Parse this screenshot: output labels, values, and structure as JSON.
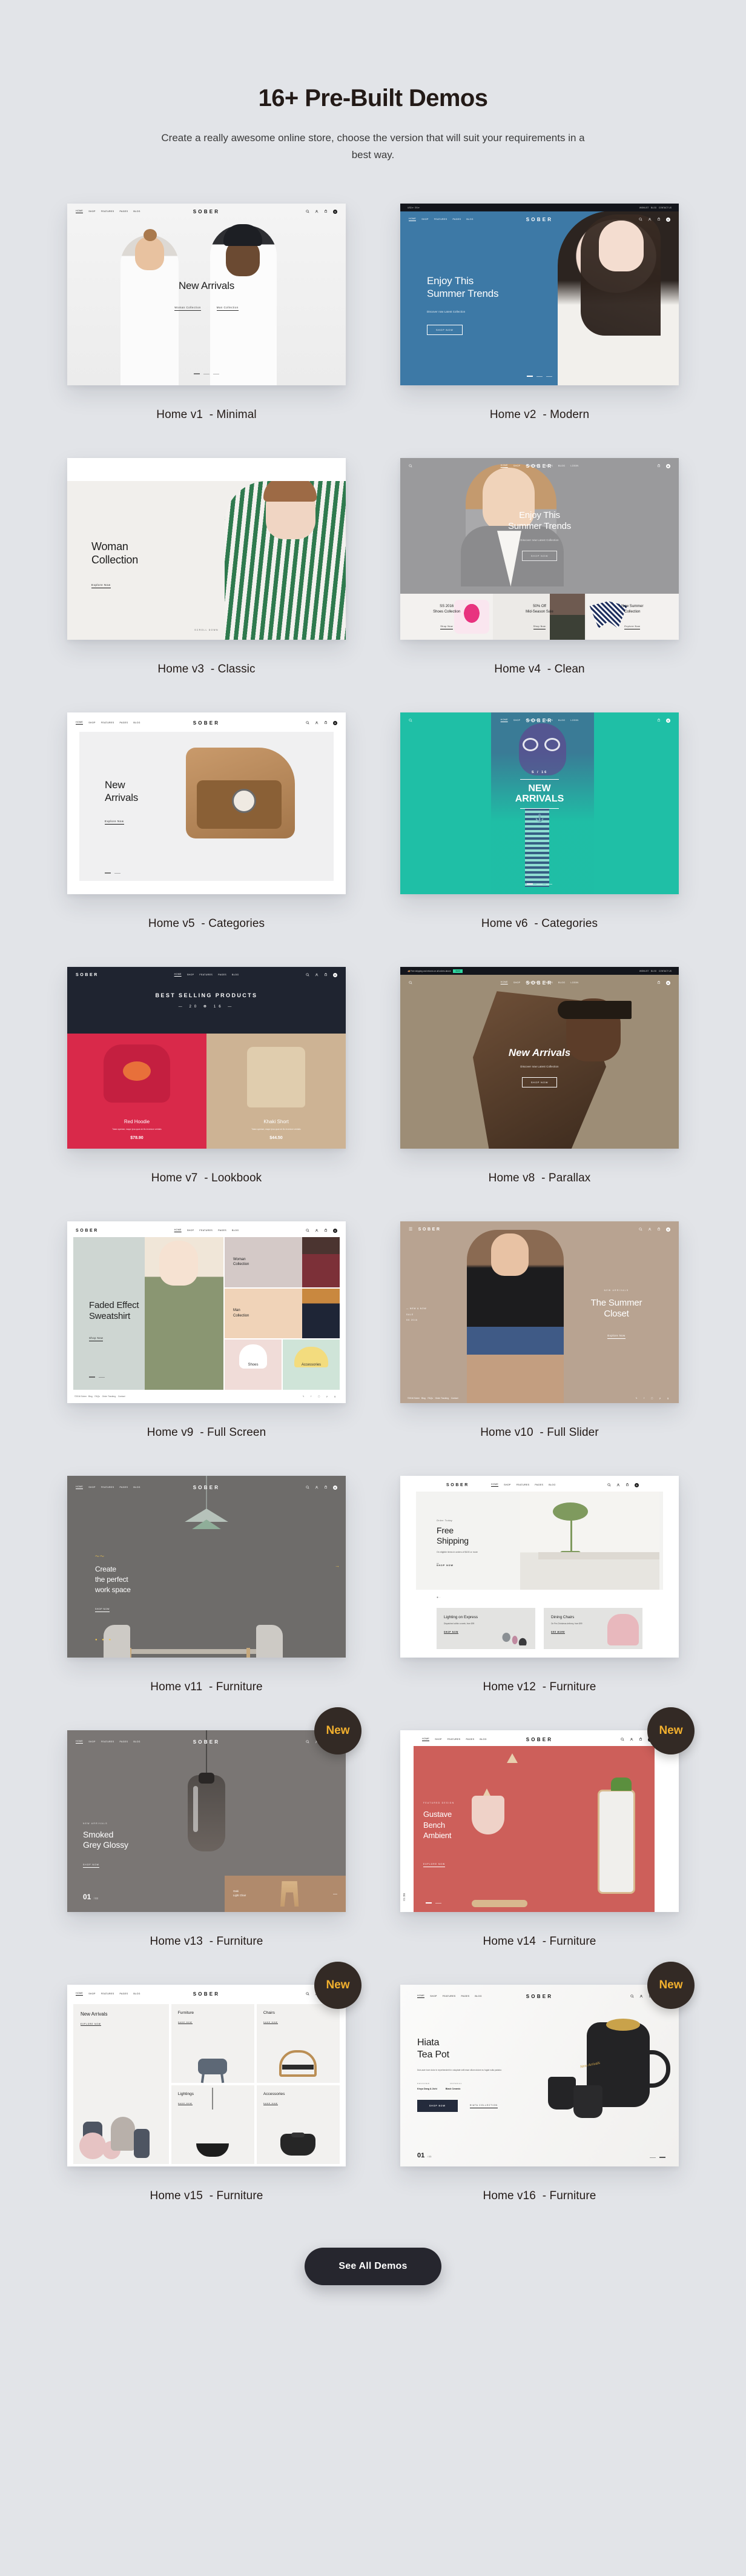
{
  "header": {
    "title": "16+ Pre-Built Demos",
    "subtitle": "Create a really awesome online store, choose the version that will suit your requirements in a best way."
  },
  "brand": "SOBER",
  "nav": {
    "items": [
      "HOME",
      "SHOP",
      "FEATURES",
      "PAGES",
      "BLOG",
      "LOGIN"
    ],
    "topbar_left": [
      "USD",
      "EN"
    ],
    "topbar_right": [
      "WISHLIST",
      "BLOG",
      "CONTACT US"
    ],
    "icons": [
      "search-icon",
      "user-icon",
      "cart-icon"
    ],
    "cart_count": "0"
  },
  "badge_new_label": "New",
  "colors": {
    "page_bg": "#e2e4e8",
    "heading": "#231a17",
    "badge_bg": "#332a25",
    "badge_text": "#f2b02e",
    "cta_bg": "#26262e",
    "v2_blue": "#3d79a6",
    "v6_teal": "#1fbfa6",
    "v7_red": "#d9294a",
    "v7_khaki": "#cdb394",
    "v7_dark": "#1f2430",
    "v8_taupe": "#9d8d76",
    "v10_beige": "#b8a391",
    "v11_grey": "#6e6c6a",
    "v13_grey": "#7a7674",
    "v14_coral": "#cd5f5a"
  },
  "demos": [
    {
      "id": "v1",
      "label": "Home v1  - Minimal",
      "badge": null,
      "hero": {
        "title": "New Arrivals",
        "links": [
          "Woman Collection",
          "Man Collection"
        ]
      }
    },
    {
      "id": "v2",
      "label": "Home v2  - Modern",
      "badge": null,
      "hero": {
        "title": "Enjoy This\nSummer Trends",
        "subtitle": "Discover now Latest Collection",
        "button": "SHOP NOW"
      }
    },
    {
      "id": "v3",
      "label": "Home v3  - Classic",
      "badge": null,
      "hero": {
        "title": "Woman\nCollection",
        "link": "Explore Now",
        "scroll": "SCROLL DOWN"
      }
    },
    {
      "id": "v4",
      "label": "Home v4  - Clean",
      "badge": null,
      "hero": {
        "title": "Enjoy This\nSummer Trends",
        "subtitle": "Discover now Latest Collection",
        "button": "SHOP NOW"
      },
      "tiles": [
        {
          "title": "SS 2016\nShoes Collection",
          "link": "Shop Now"
        },
        {
          "title": "50% Off\nMid-Season Sale",
          "link": "Shop Now"
        },
        {
          "title": "New Summer\nCollection",
          "link": "Explore Now"
        }
      ]
    },
    {
      "id": "v5",
      "label": "Home v5  - Categories",
      "badge": null,
      "hero": {
        "title": "New\nArrivals",
        "link": "Explore Now"
      }
    },
    {
      "id": "v6",
      "label": "Home v6  - Categories",
      "badge": null,
      "hero": {
        "season": "S / 16",
        "title": "NEW\nARRIVALS"
      }
    },
    {
      "id": "v7",
      "label": "Home v7  - Lookbook",
      "badge": null,
      "hero": {
        "title": "BEST SELLING PRODUCTS",
        "year": "2016"
      },
      "products": [
        {
          "name": "Red Hoodie",
          "desc": "Totam aperiam, eaque ipsa quae ab illo inventore veritatis",
          "price": "$78.90"
        },
        {
          "name": "Khaki Short",
          "desc": "Totam aperiam, eaque ipsa quae ab illo inventore veritatis",
          "price": "$44.50"
        }
      ]
    },
    {
      "id": "v8",
      "label": "Home v8  - Parallax",
      "badge": null,
      "announce": "Free shipping and returns on all orders above",
      "announce_tag": "$100",
      "hero": {
        "title": "New Arrivals",
        "subtitle": "Discover now Latest Collection",
        "button": "SHOP NOW"
      }
    },
    {
      "id": "v9",
      "label": "Home v9  - Full Screen",
      "badge": null,
      "hero": {
        "title": "Faded Effect\nSweatshirt",
        "link": "Shop Now"
      },
      "tiles": [
        {
          "title": "Woman\nCollection"
        },
        {
          "title": "Man\nCollection"
        },
        {
          "title": "Shoes"
        },
        {
          "title": "Accessories"
        }
      ],
      "footer": {
        "copy": "©2016 Sober",
        "links": [
          "Blog",
          "FAQs",
          "Order Tracking",
          "Contact"
        ]
      }
    },
    {
      "id": "v10",
      "label": "Home v10  - Full Slider",
      "badge": null,
      "hero": {
        "eyebrow": "NEW ARRIVALS",
        "title": "The Summer\nCloset",
        "link": "Explore Now",
        "side_nav": [
          "NEW & NOW",
          "SALE",
          "SS 2016"
        ]
      },
      "footer": {
        "copy": "©2016 Sober",
        "links": [
          "Blog",
          "FAQs",
          "Order Tracking",
          "Contact"
        ]
      }
    },
    {
      "id": "v11",
      "label": "Home v11  - Furniture",
      "badge": null,
      "hero": {
        "title": "Create\nthe perfect\nwork space",
        "button": "SHOP NOW"
      }
    },
    {
      "id": "v12",
      "label": "Home v12  - Furniture",
      "badge": null,
      "hero": {
        "eyebrow": "Order Today",
        "title": "Free\nShipping",
        "subtitle": "On eligible items in orders of $100 or more",
        "button": "SHOP NOW"
      },
      "tiles": [
        {
          "title": "Lighting on Express",
          "desc": "Dispatched within a week, from $99",
          "link": "SHOP NOW"
        },
        {
          "title": "Dining Chairs",
          "desc": "On Pre-Christmas delivery, from $99",
          "link": "SEE MORE"
        }
      ]
    },
    {
      "id": "v13",
      "label": "Home v13  - Furniture",
      "badge": "New",
      "hero": {
        "eyebrow": "NEW ARRIVALS",
        "title": "Smoked\nGrey Glossy",
        "link": "SHOP NOW",
        "counter": "01",
        "counter_total": "/ 03"
      },
      "tile": {
        "title": "Oaki\nLight Chair"
      }
    },
    {
      "id": "v14",
      "label": "Home v14  - Furniture",
      "badge": "New",
      "hero": {
        "eyebrow": "FEATURED DESIGN",
        "title": "Gustave\nBench\nAmbient",
        "link": "EXPLORE NOW",
        "counter": "01",
        "counter_total": "/ 03"
      }
    },
    {
      "id": "v15",
      "label": "Home v15  - Furniture",
      "badge": "New",
      "tiles": [
        {
          "title": "New Arrivals",
          "link": "EXPLORE NOW"
        },
        {
          "title": "Furniture",
          "link": "SHOP NOW"
        },
        {
          "title": "Chairs",
          "link": "SHOP NOW"
        },
        {
          "title": "Lightings",
          "link": "SHOP NOW"
        },
        {
          "title": "Accessories",
          "link": "SHOP NOW"
        }
      ]
    },
    {
      "id": "v16",
      "label": "Home v16  - Furniture",
      "badge": "New",
      "hero": {
        "title": "Hiata\nTea Pot",
        "desc": "Duis aute irure dolor in reprehenderit in voluptate velit esse cillum dolore eu fugiat nulla pariatur.",
        "spec_labels": [
          "DESIGNER",
          "MATERIAL"
        ],
        "spec_values": [
          "Kinyu Dang & Jichi",
          "Black Ceramic"
        ],
        "button": "SHOP NOW",
        "link": "HIATA COLLECTION",
        "sticker": "New Arrivals",
        "counter": "01",
        "counter_total": "/ 03"
      }
    }
  ],
  "cta": {
    "label": "See All Demos"
  }
}
